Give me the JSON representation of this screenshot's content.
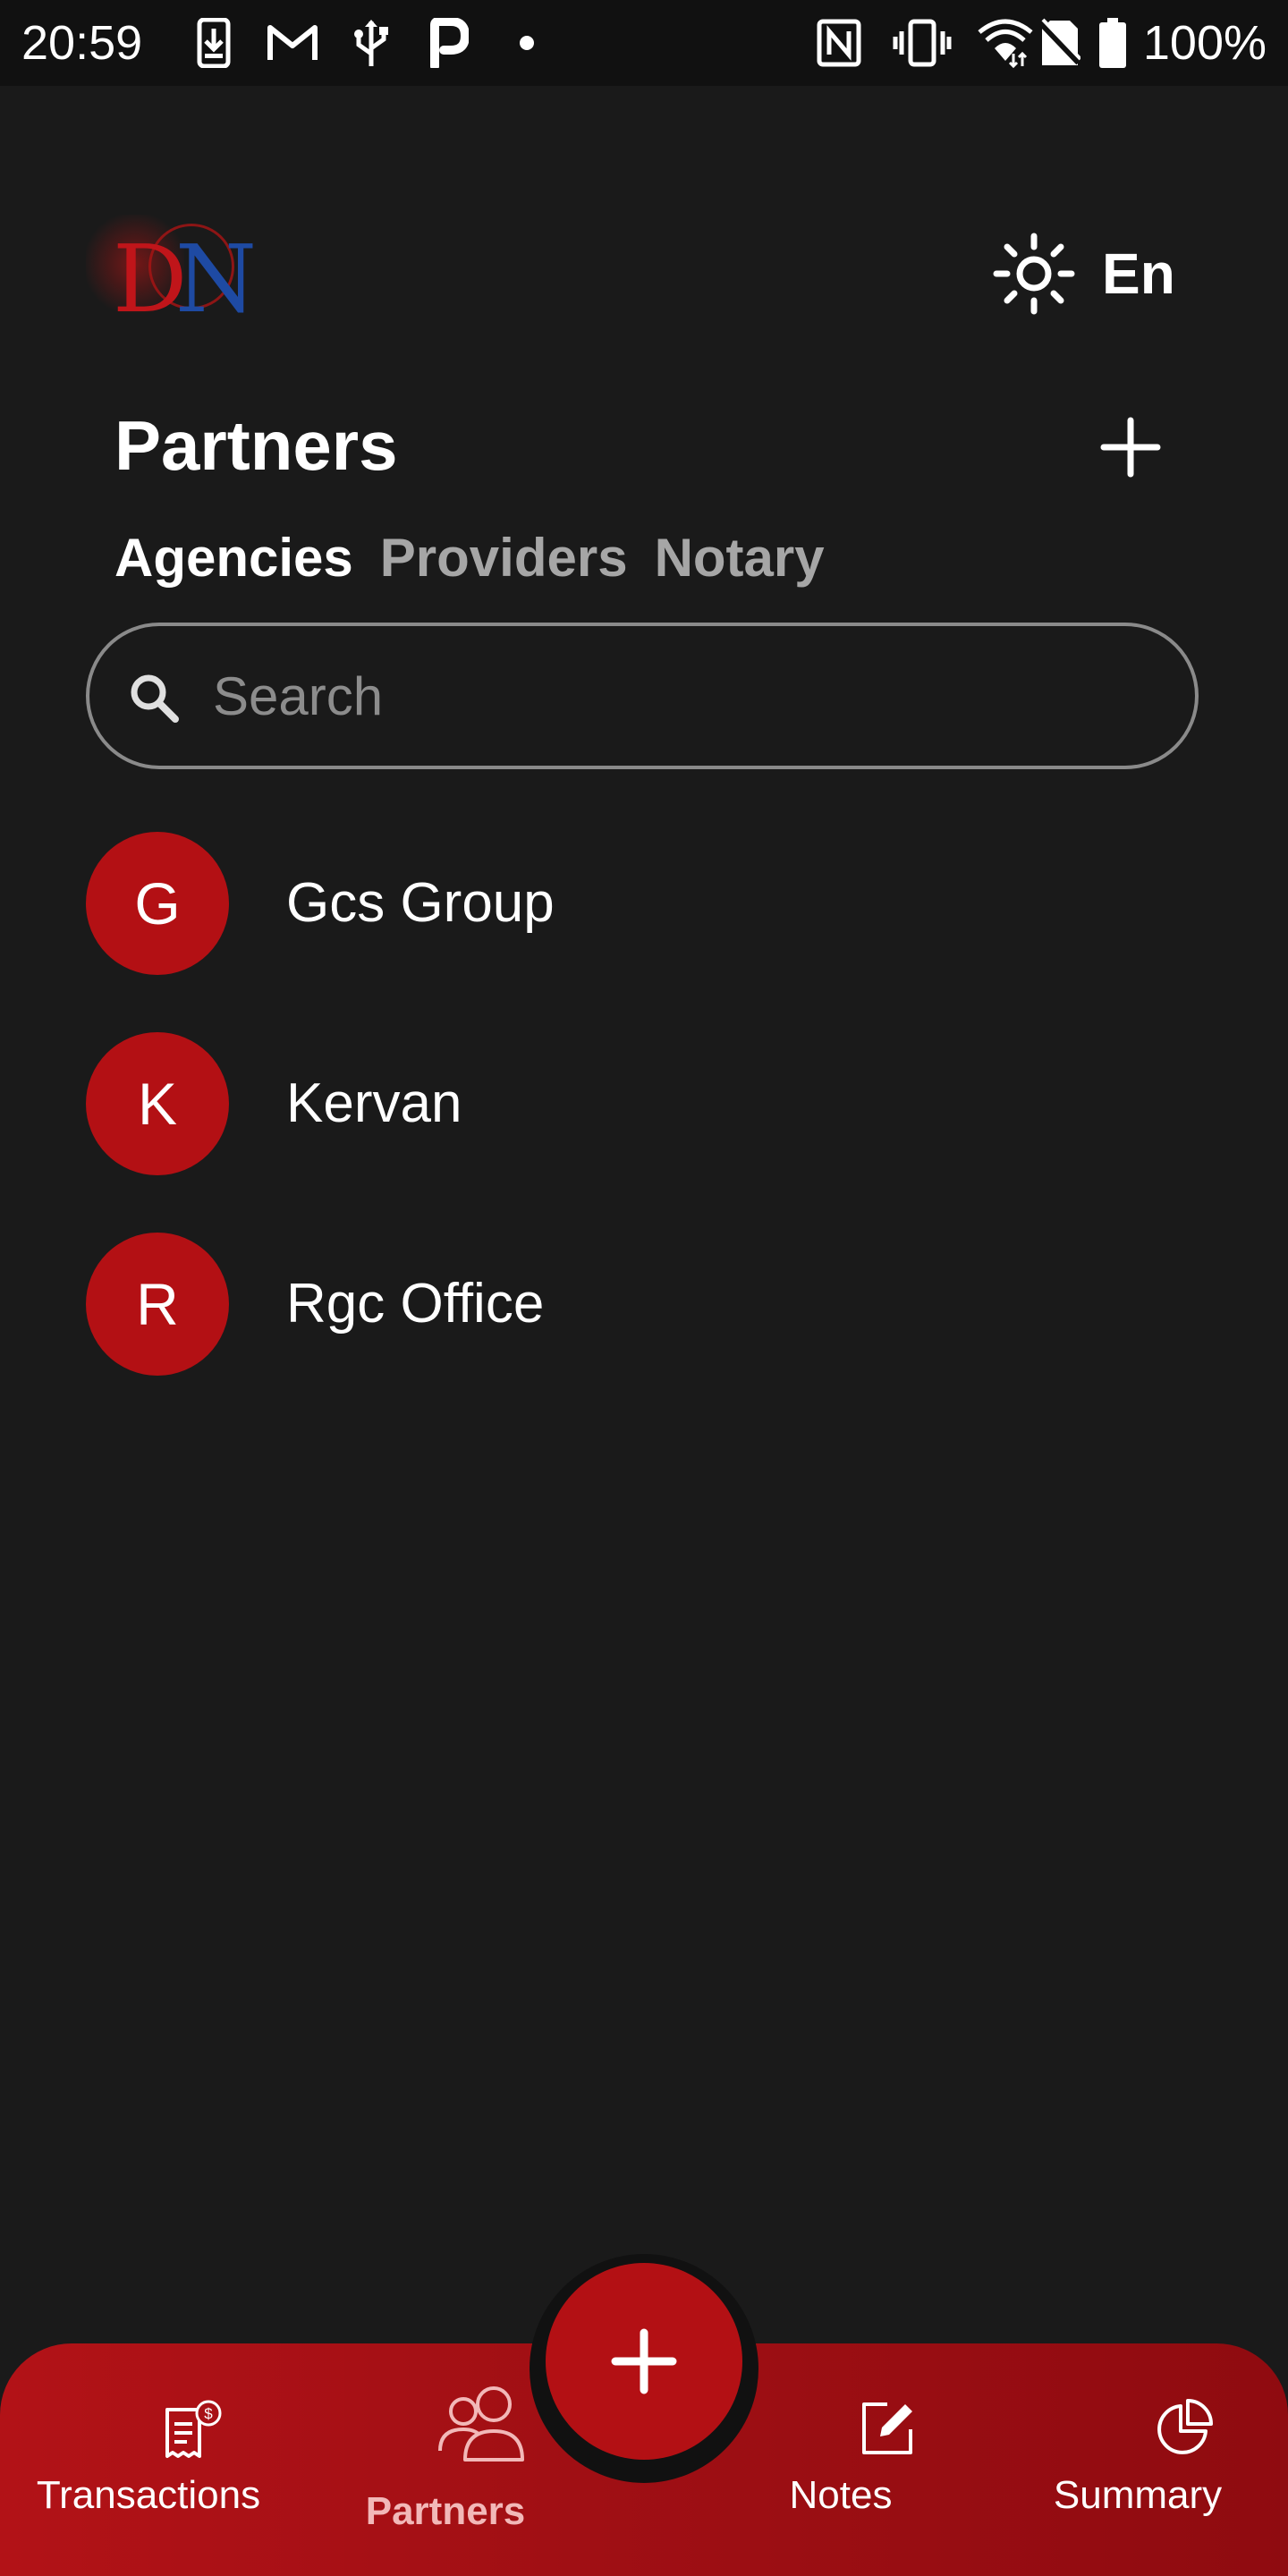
{
  "status_bar": {
    "time": "20:59",
    "battery_text": "100%",
    "left_icons": [
      "download-icon",
      "gmail-icon",
      "usb-icon",
      "parking-icon",
      "dot-icon"
    ],
    "right_icons": [
      "nfc-icon",
      "vibrate-icon",
      "wifi-icon",
      "no-sim-icon",
      "battery-icon"
    ]
  },
  "header": {
    "logo_letters": [
      "D",
      "N"
    ],
    "theme_icon": "sun-icon",
    "language": "En"
  },
  "page": {
    "title": "Partners",
    "add_icon": "plus-icon"
  },
  "tabs": [
    {
      "label": "Agencies",
      "active": true
    },
    {
      "label": "Providers",
      "active": false
    },
    {
      "label": "Notary",
      "active": false
    }
  ],
  "search": {
    "placeholder": "Search",
    "value": ""
  },
  "partners": [
    {
      "initial": "G",
      "name": "Gcs Group"
    },
    {
      "initial": "K",
      "name": "Kervan"
    },
    {
      "initial": "R",
      "name": "Rgc Office"
    }
  ],
  "bottom_nav": {
    "items": [
      {
        "label": "Transactions",
        "icon": "receipt-dollar-icon",
        "active": false
      },
      {
        "label": "Partners",
        "icon": "people-icon",
        "active": true
      },
      {
        "label": "Notes",
        "icon": "edit-note-icon",
        "active": false
      },
      {
        "label": "Summary",
        "icon": "pie-chart-icon",
        "active": false
      }
    ],
    "fab_icon": "plus-icon"
  },
  "colors": {
    "background": "#1a1a1a",
    "accent": "#b31014",
    "inactive_tab": "#a6a6a6"
  }
}
